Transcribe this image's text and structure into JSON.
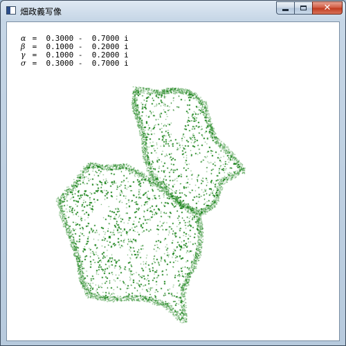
{
  "window": {
    "title": "畑政義写像",
    "close_glyph": "✕"
  },
  "params": [
    {
      "symbol": "α",
      "text": " =  0.3000 -  0.7000 i"
    },
    {
      "symbol": "β",
      "text": " =  0.1000 -  0.2000 i"
    },
    {
      "symbol": "γ",
      "text": " =  0.1000 -  0.2000 i"
    },
    {
      "symbol": "σ",
      "text": " =  0.3000 -  0.7000 i"
    }
  ],
  "colors": {
    "fractal": "#0a7a0a",
    "client_background": "#ffffff"
  }
}
